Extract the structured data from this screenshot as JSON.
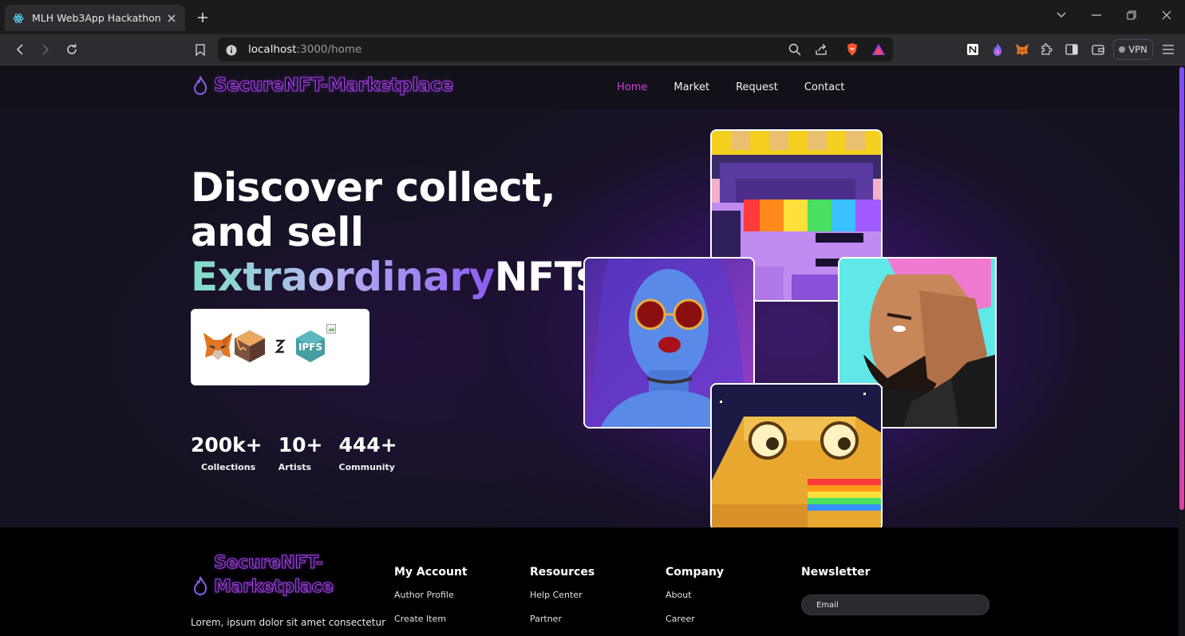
{
  "browser": {
    "tab_title": "MLH Web3App Hackathon",
    "url_host": "localhost",
    "url_path": ":3000/home",
    "vpn_label": "VPN"
  },
  "site": {
    "logo_text": "SecureNFT-Marketplace",
    "nav": [
      "Home",
      "Market",
      "Request",
      "Contact"
    ],
    "nav_active": "Home",
    "accent": "#c040e8"
  },
  "hero": {
    "line1": "Discover collect,",
    "line2": "and sell",
    "highlight": "Extraordinary",
    "line3_rest": "NFTs",
    "tech_icons": [
      "metamask-icon",
      "thirdweb-box-icon",
      "sync-icon",
      "ipfs-icon",
      "broken-image-icon"
    ],
    "ipfs_label": "IPFS",
    "stats": [
      {
        "value": "200k+",
        "label": "Collections"
      },
      {
        "value": "10+",
        "label": "Artists"
      },
      {
        "value": "444+",
        "label": "Community"
      }
    ]
  },
  "footer": {
    "logo_line1": "SecureNFT-",
    "logo_line2": "Marketplace",
    "description": "Lorem, ipsum dolor sit amet consectetur",
    "columns": [
      {
        "title": "My Account",
        "links": [
          "Author Profile",
          "Create Item"
        ]
      },
      {
        "title": "Resources",
        "links": [
          "Help Center",
          "Partner"
        ]
      },
      {
        "title": "Company",
        "links": [
          "About",
          "Career"
        ]
      }
    ],
    "newsletter_title": "Newsletter",
    "email_placeholder": "Email"
  }
}
